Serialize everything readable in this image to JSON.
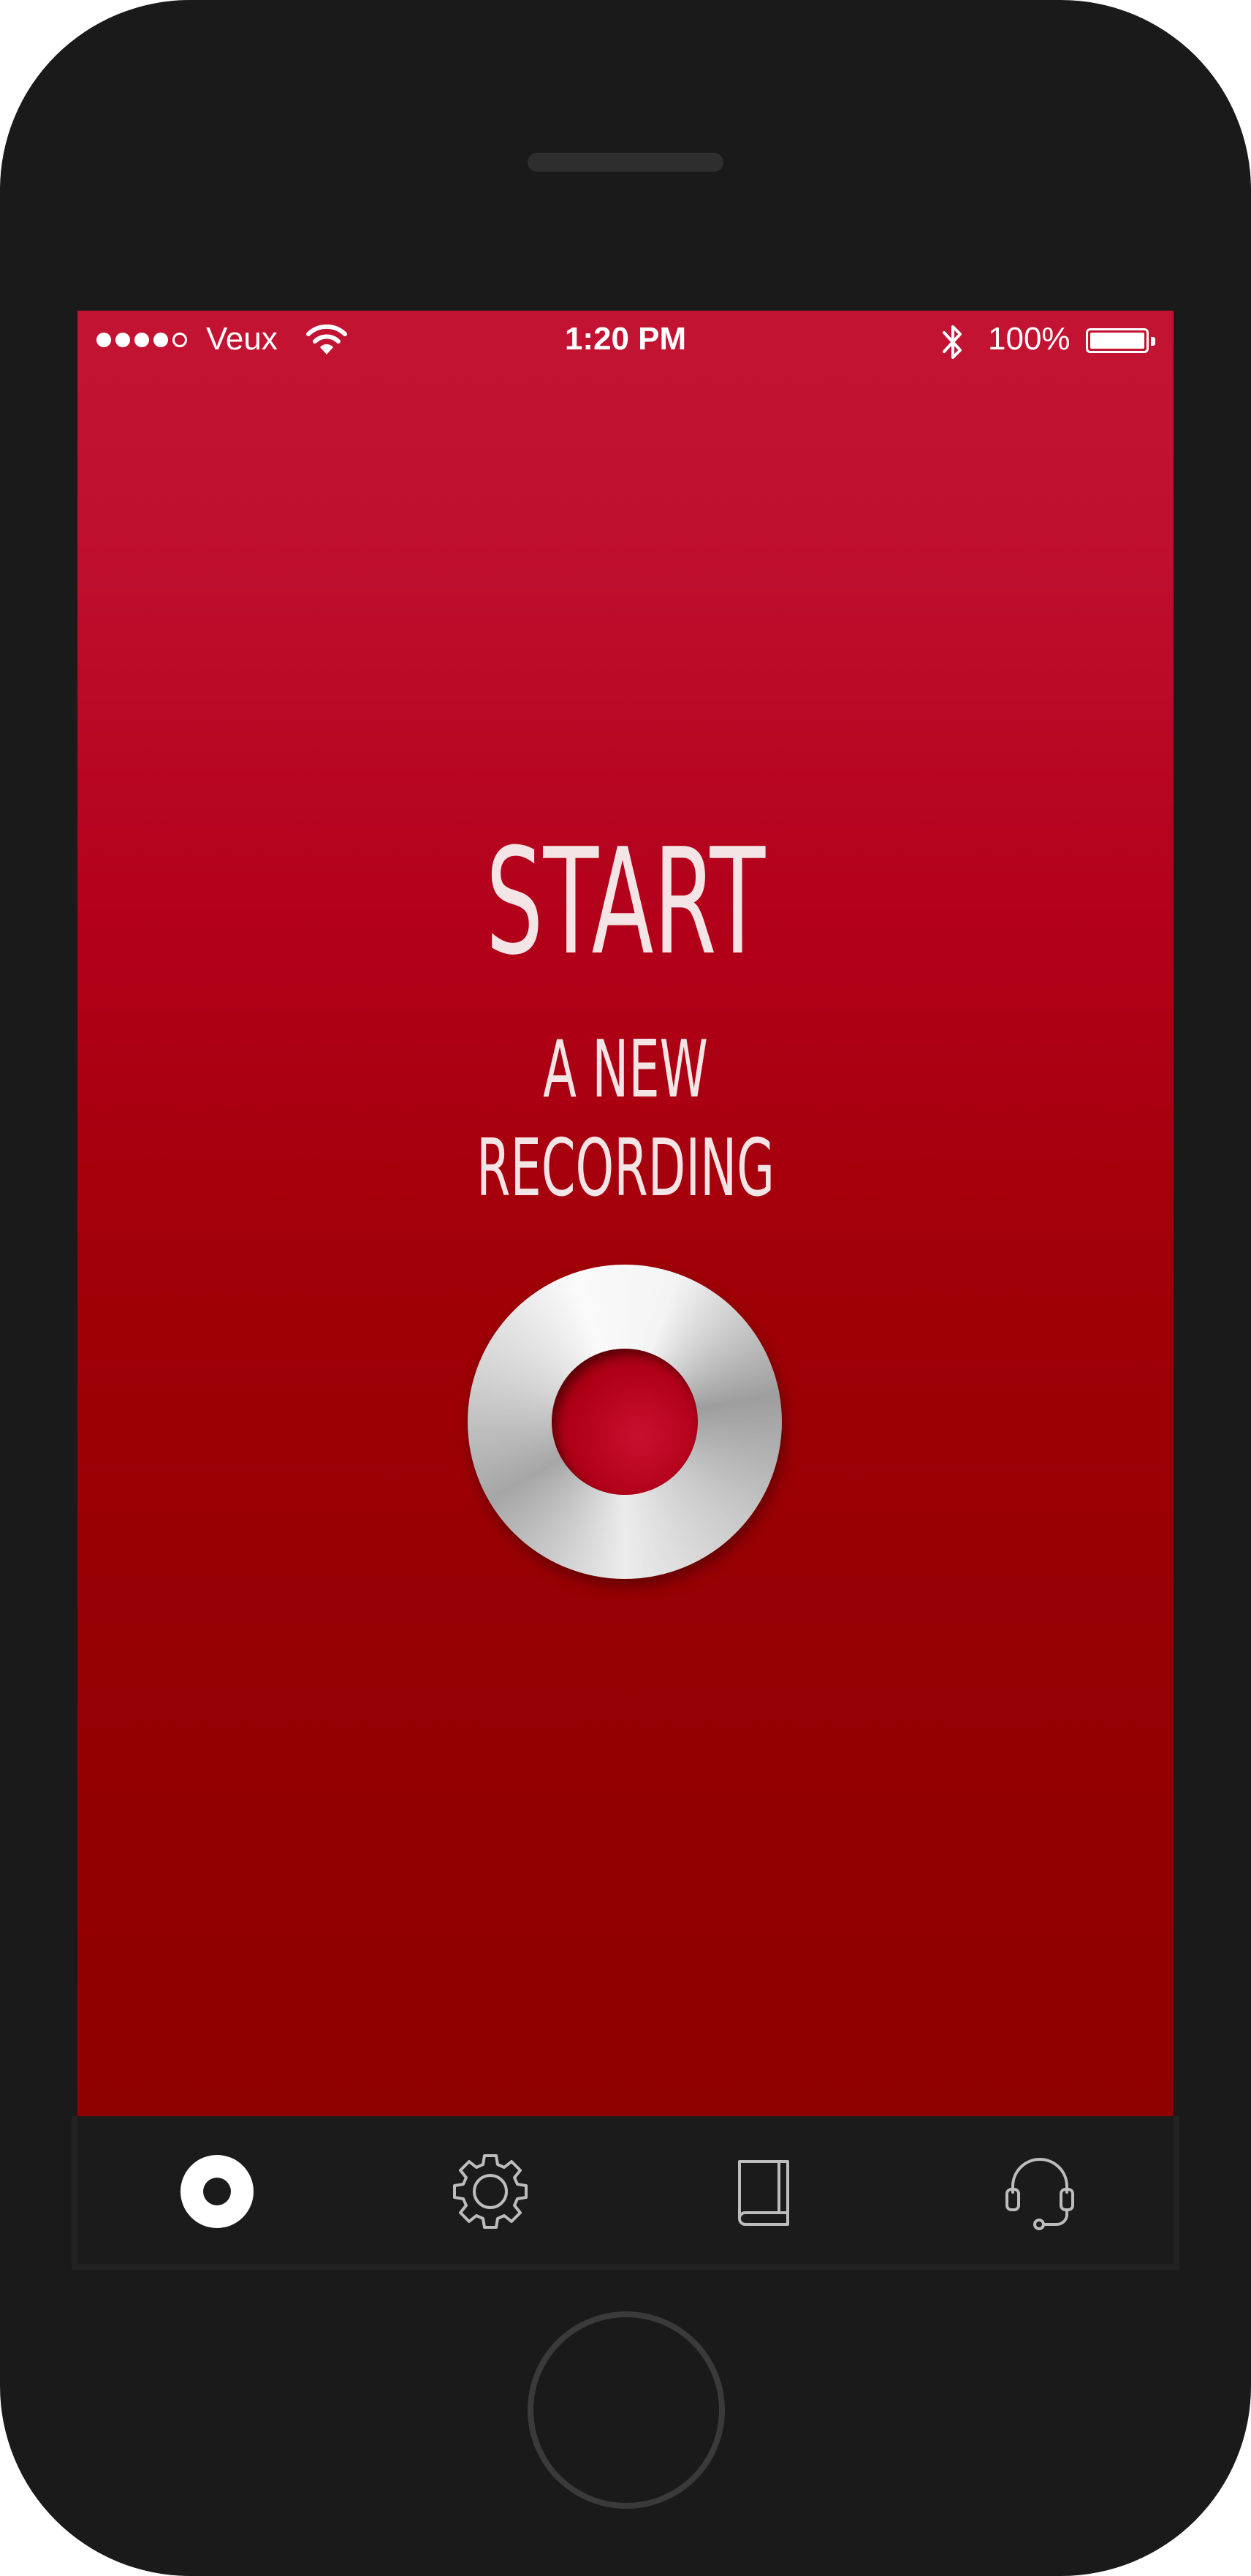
{
  "status_bar": {
    "carrier": "Veux",
    "time": "1:20 PM",
    "battery_percent_label": "100%",
    "battery_level": 1.0,
    "signal_bars_filled": 4,
    "signal_bars_total": 5
  },
  "main": {
    "title": "START",
    "subtitle_line1": "A NEW",
    "subtitle_line2": "RECORDING"
  },
  "tab_bar": {
    "tabs": [
      {
        "icon": "record-icon",
        "active": true
      },
      {
        "icon": "gear-icon",
        "active": false
      },
      {
        "icon": "book-icon",
        "active": false
      },
      {
        "icon": "headset-icon",
        "active": false
      }
    ]
  },
  "colors": {
    "accent": "#b00018",
    "frame": "#1a1a1a",
    "text": "#f3e4e6"
  }
}
